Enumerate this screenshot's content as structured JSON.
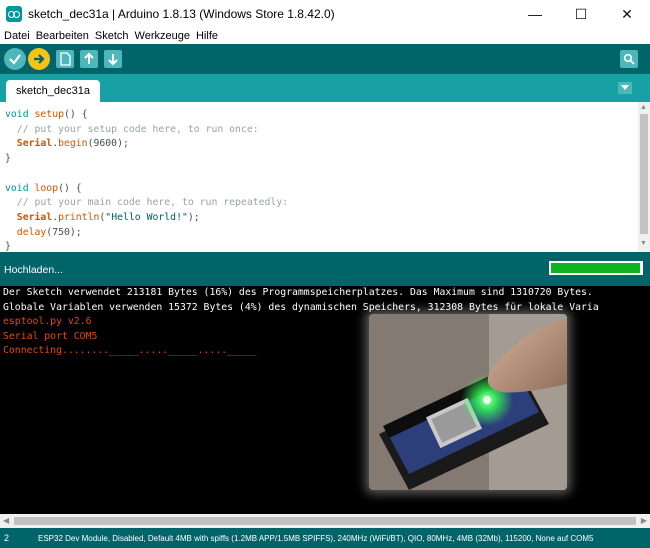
{
  "window": {
    "title": "sketch_dec31a | Arduino 1.8.13 (Windows Store 1.8.42.0)",
    "minimize": "—",
    "maximize": "☐",
    "close": "✕"
  },
  "menu": [
    "Datei",
    "Bearbeiten",
    "Sketch",
    "Werkzeuge",
    "Hilfe"
  ],
  "toolbar": {
    "verify_icon": "checkmark-icon",
    "upload_icon": "arrow-right-icon",
    "new_icon": "new-file-icon",
    "open_icon": "arrow-up-icon",
    "save_icon": "arrow-down-icon",
    "serial_icon": "magnifier-icon"
  },
  "tabs": [
    {
      "label": "sketch_dec31a"
    }
  ],
  "tab_menu_icon": "chevron-down-icon",
  "status": {
    "text": "Hochladen...",
    "progress": 0.97
  },
  "console": {
    "lines": [
      {
        "text": "Der Sketch verwendet 213181 Bytes (16%) des Programmspeicherplatzes. Das Maximum sind 1310720 Bytes.",
        "color": "white"
      },
      {
        "text": "Globale Variablen verwenden 15372 Bytes (4%) des dynamischen Speichers, 312308 Bytes für lokale Varia",
        "color": "white"
      },
      {
        "text": "esptool.py v2.6",
        "color": "orange"
      },
      {
        "text": "Serial port COM5",
        "color": "orange"
      },
      {
        "text": "Connecting........_____....._____....._____",
        "color": "orange"
      }
    ]
  },
  "footer": {
    "line": "2",
    "board": "ESP32 Dev Module, Disabled, Default 4MB with spiffs (1.2MB APP/1.5MB SPIFFS), 240MHz (WiFi/BT), QIO, 80MHz, 4MB (32Mb), 115200, None auf COM5"
  },
  "colors": {
    "teal_dark": "#006468",
    "teal": "#17a1a5",
    "button": "#4db7bb",
    "upload": "#f3c416",
    "progress": "#11b321",
    "console_orange": "#e34c00"
  }
}
